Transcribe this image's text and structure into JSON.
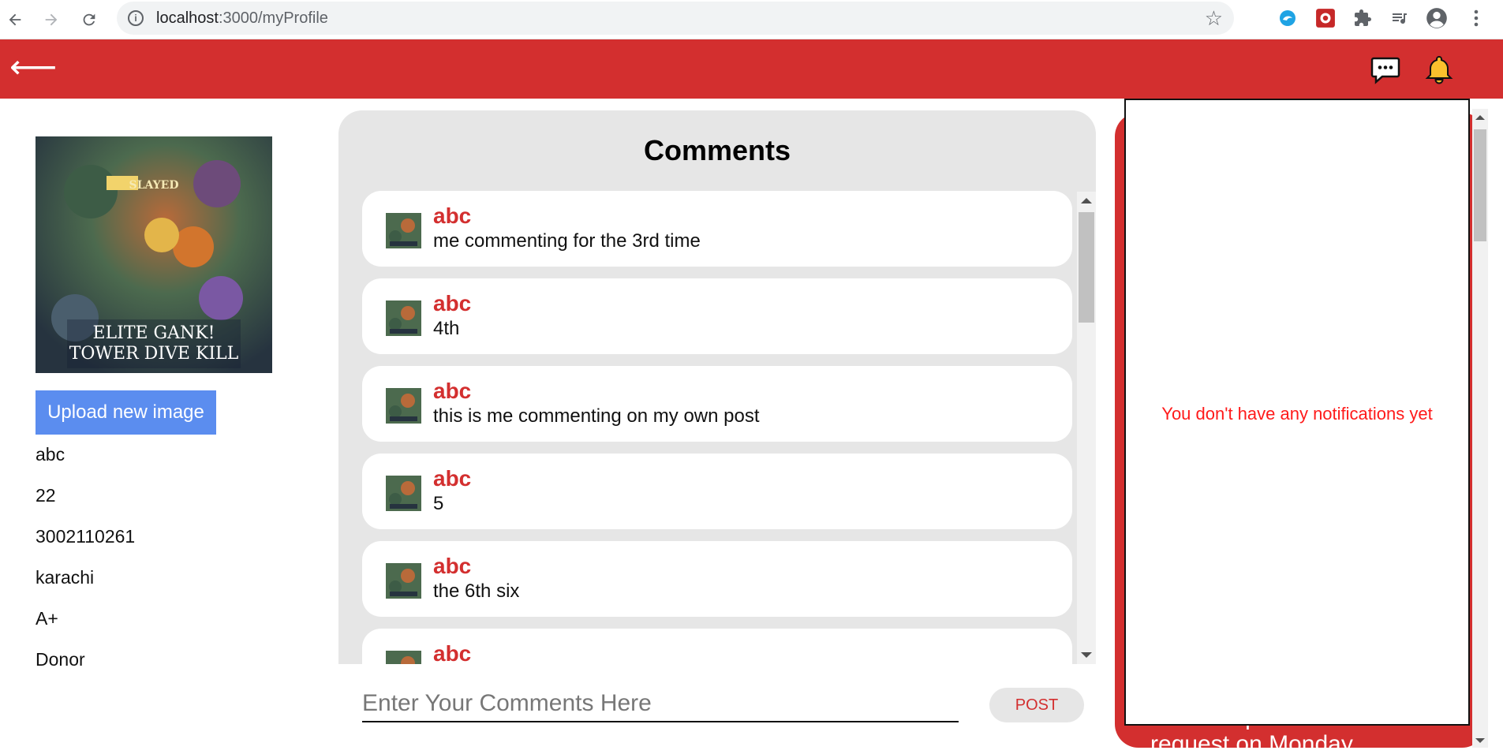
{
  "browser": {
    "url_host": "localhost",
    "url_path": ":3000/myProfile"
  },
  "header": {
    "back_glyph": "⟵",
    "color": "#d32f2f"
  },
  "profile": {
    "image_caption_line1": "ELITE GANK!",
    "image_caption_line2": "TOWER DIVE KILL",
    "image_badge": "SLAYED",
    "upload_label": "Upload new image",
    "name": "abc",
    "age": "22",
    "phone": "3002110261",
    "city": "karachi",
    "blood_group": "A+",
    "role": "Donor"
  },
  "comments": {
    "title": "Comments",
    "items": [
      {
        "name": "abc",
        "text": "me commenting for the 3rd time"
      },
      {
        "name": "abc",
        "text": "4th"
      },
      {
        "name": "abc",
        "text": "this is me commenting on my own post"
      },
      {
        "name": "abc",
        "text": "5"
      },
      {
        "name": "abc",
        "text": "the 6th six"
      },
      {
        "name": "abc",
        "text": ""
      }
    ],
    "input_placeholder": "Enter Your Comments Here",
    "post_label": "POST"
  },
  "notifications": {
    "empty_text": "You don't have any notifications yet",
    "background_text": "abc accepted b's blood request on Monday"
  }
}
